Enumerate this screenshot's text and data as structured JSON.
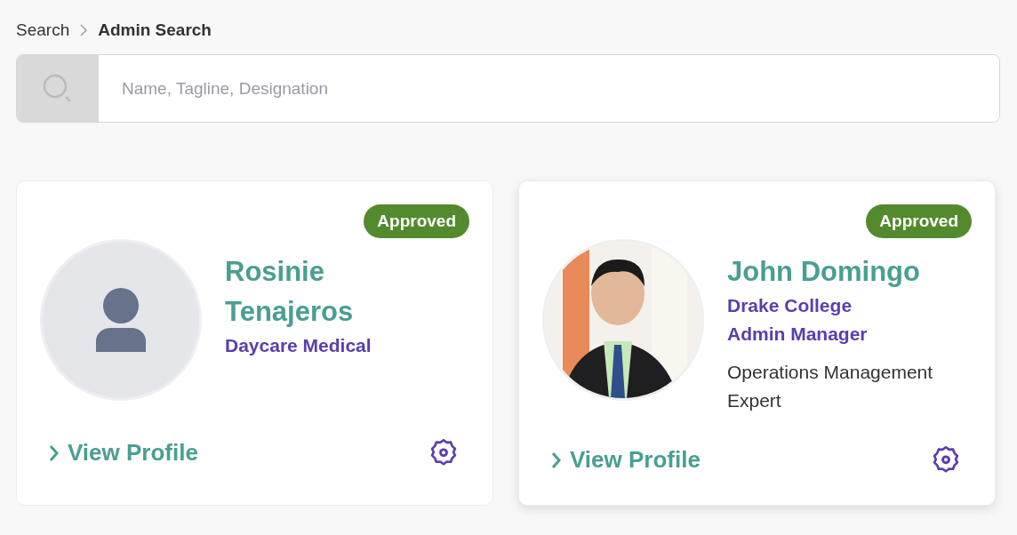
{
  "breadcrumb": [
    {
      "label": "Search",
      "current": false
    },
    {
      "label": "Admin Search",
      "current": true
    }
  ],
  "search": {
    "placeholder": "Name, Tagline, Designation"
  },
  "cards": [
    {
      "status": "Approved",
      "avatar": {
        "kind": "placeholder"
      },
      "name": "Rosinie Tenajeros",
      "lines": [
        "Daycare Medical"
      ],
      "link": "View Profile",
      "raised": false
    },
    {
      "status": "Approved",
      "name": "John Domingo",
      "lines": [
        "Drake College",
        "Admin Manager"
      ],
      "description": "Operations Management Expert",
      "link": "View Profile",
      "raised": true
    }
  ]
}
